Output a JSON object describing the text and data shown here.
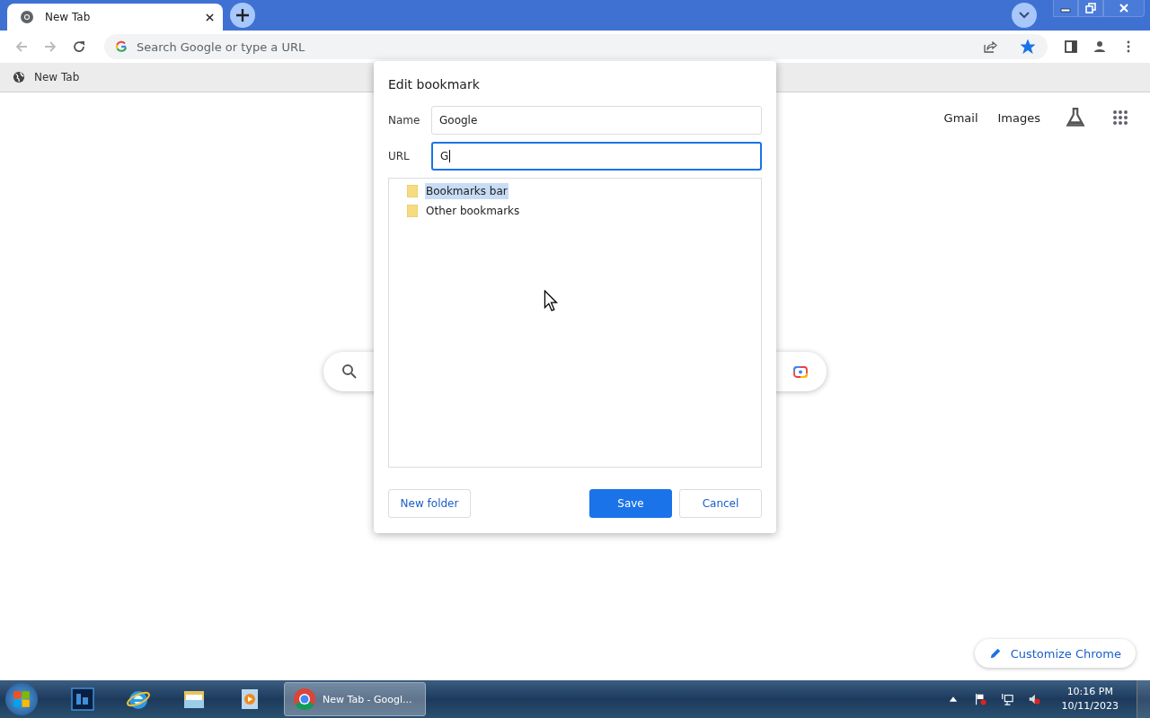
{
  "tabs": [
    {
      "title": "New Tab",
      "selected": true
    }
  ],
  "omnibox": {
    "placeholder": "Search Google or type a URL",
    "bookmarked": true
  },
  "bookmarks_bar": [
    {
      "label": "New Tab"
    }
  ],
  "header_links": [
    "Gmail",
    "Images"
  ],
  "dialog": {
    "title": "Edit bookmark",
    "name_label": "Name",
    "name_value": "Google",
    "url_label": "URL",
    "url_value": "G",
    "folders": [
      {
        "label": "Bookmarks bar",
        "selected": true
      },
      {
        "label": "Other bookmarks",
        "selected": false
      }
    ],
    "buttons": [
      {
        "label": "New folder",
        "kind": "secondary"
      },
      {
        "label": "Save",
        "kind": "primary"
      },
      {
        "label": "Cancel",
        "kind": "secondary"
      }
    ]
  },
  "customize_button": "Customize Chrome",
  "taskbar": {
    "apps": [
      {
        "kind": "photoshop"
      },
      {
        "kind": "ie"
      },
      {
        "kind": "explorer"
      },
      {
        "kind": "media"
      }
    ],
    "windows": [
      {
        "label": "New Tab - Googl...",
        "selected": true
      }
    ],
    "time": "10:16 PM",
    "date": "10/11/2023"
  }
}
